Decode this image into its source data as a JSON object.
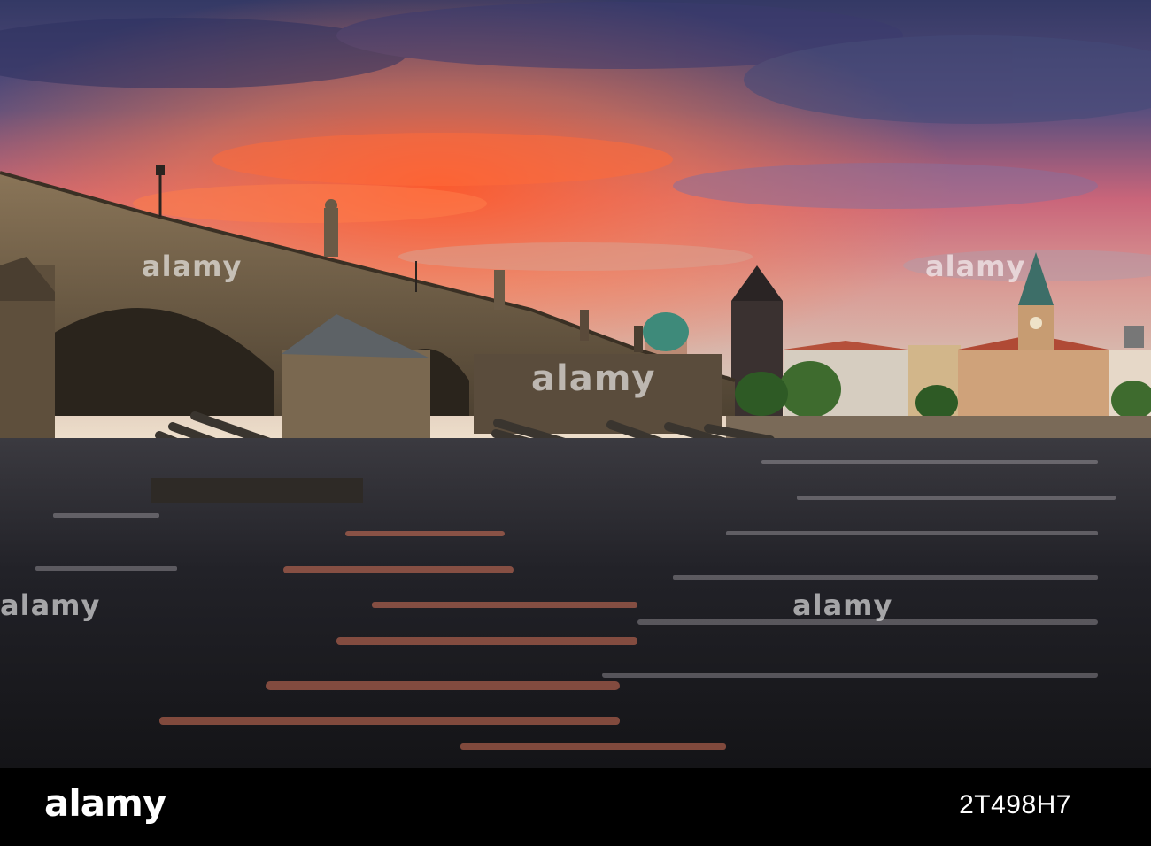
{
  "watermark": {
    "brand": "alamy"
  },
  "footer": {
    "brand": "alamy",
    "image_id": "2T498H7"
  },
  "colors": {
    "sky_top": "#3a3f6e",
    "sky_glow": "#ff6a3a",
    "sky_horizon": "#e8c9a8",
    "stone": "#6b5a44",
    "water": "#1e2024",
    "footer_bg": "#000000"
  }
}
